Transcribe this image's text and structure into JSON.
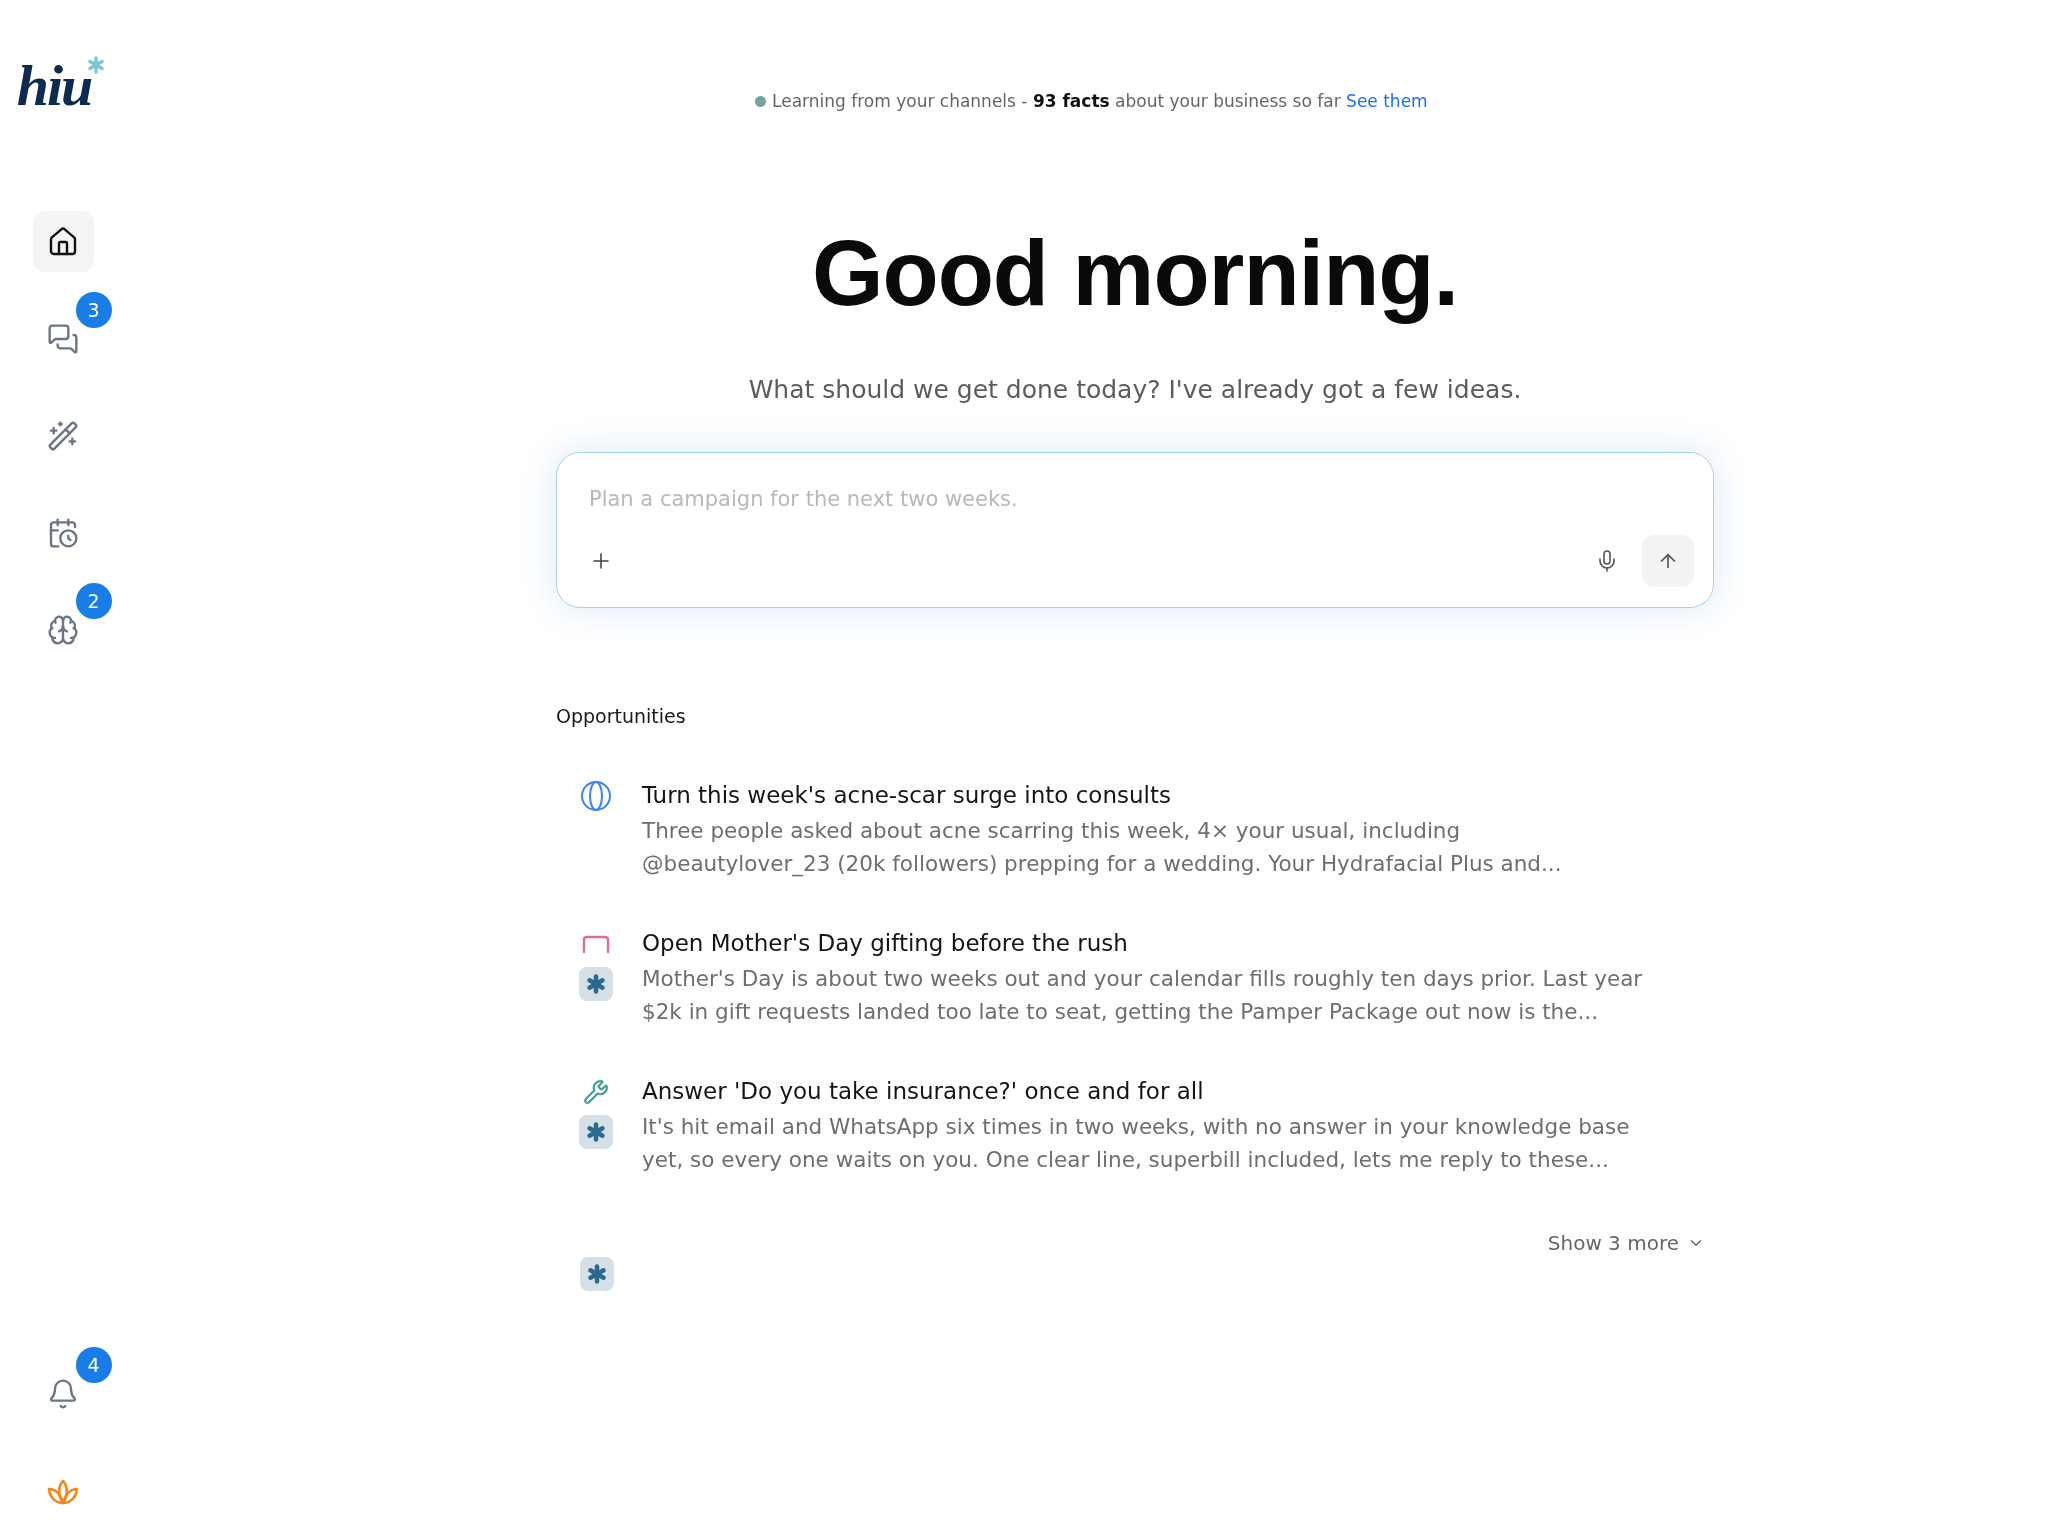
{
  "sidebar": {
    "logo": {
      "text": "hiu"
    },
    "nav": [
      {
        "kind": "home",
        "selected": true
      },
      {
        "kind": "chat",
        "selected": false,
        "badge": "3"
      },
      {
        "kind": "wand",
        "selected": false
      },
      {
        "kind": "calendar",
        "selected": false
      },
      {
        "kind": "brain",
        "selected": false,
        "badge": "2"
      }
    ],
    "footer": [
      {
        "kind": "bell",
        "badge": "4"
      },
      {
        "kind": "lotus"
      }
    ]
  },
  "status": {
    "message": "Learning from your channels - **93 facts** about your business so far",
    "link": "See them"
  },
  "greeting": {
    "title": "Good morning.",
    "subtitle": "What should we get done today? I've already got a few ideas."
  },
  "composer": {
    "placeholder": "Plan a campaign for the next two weeks."
  },
  "opportunities": {
    "heading": "Opportunities",
    "items": [
      {
        "kind": "globe",
        "assistant": false,
        "title": "Turn this week's acne-scar surge into consults",
        "description": "Three people asked about acne scarring this week, 4× your usual, including @beautylover_23 (20k followers) prepping for a wedding. Your Hydrafacial Plus and..."
      },
      {
        "kind": "arch",
        "assistant": true,
        "title": "Open Mother's Day gifting before the rush",
        "description": "Mother's Day is about two weeks out and your calendar fills roughly ten days prior. Last year $2k in gift requests landed too late to seat, getting the Pamper Package out now is the..."
      },
      {
        "kind": "wrench",
        "assistant": true,
        "title": "Answer 'Do you take insurance?' once and for all",
        "description": "It's hit email and WhatsApp six times in two weeks, with no answer in your knowledge base yet, so every one waits on you. One clear line, superbill included, lets me reply to these..."
      }
    ],
    "show_more": "Show 3 more"
  }
}
